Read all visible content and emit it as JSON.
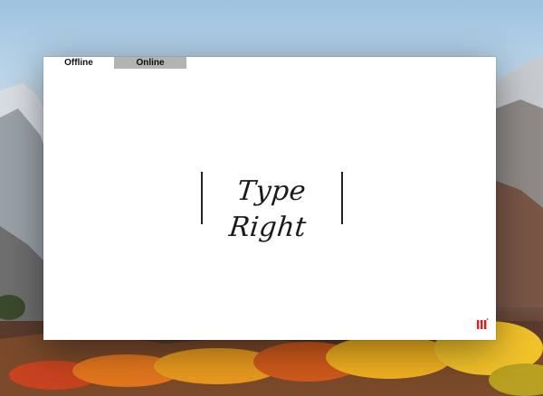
{
  "tabs": [
    {
      "label": "Offline",
      "active": true
    },
    {
      "label": "Online",
      "active": false
    }
  ],
  "logo": {
    "text": "Type Right"
  },
  "corner_icon": {
    "name": "library-icon",
    "color": "#e02020"
  },
  "colors": {
    "window_bg": "#ffffff",
    "inactive_tab_bg": "#b3b3b3",
    "accent_red": "#e02020"
  }
}
